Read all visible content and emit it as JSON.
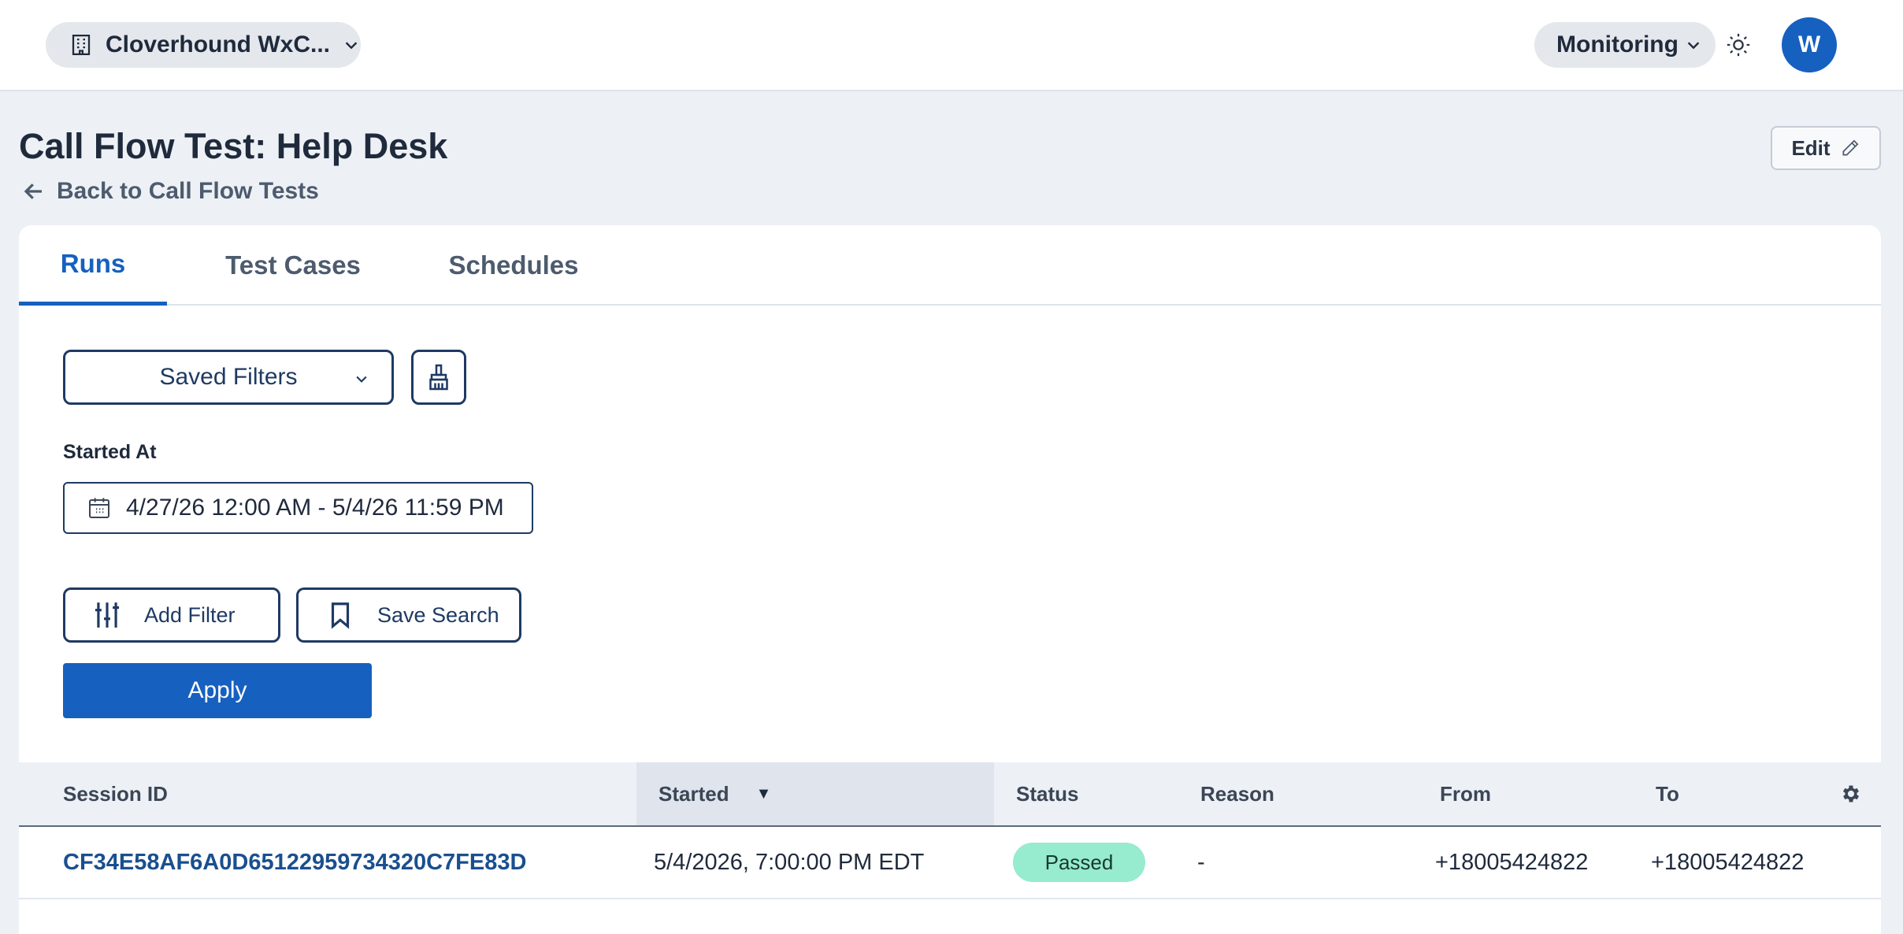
{
  "topbar": {
    "org_name": "Cloverhound WxC...",
    "section_menu": "Monitoring",
    "avatar_initial": "W"
  },
  "header": {
    "title": "Call Flow Test: Help Desk",
    "back_link": "Back to Call Flow Tests",
    "edit_label": "Edit"
  },
  "tabs": [
    {
      "label": "Runs",
      "active": true
    },
    {
      "label": "Test Cases",
      "active": false
    },
    {
      "label": "Schedules",
      "active": false
    }
  ],
  "filters": {
    "saved_filters_label": "Saved Filters",
    "started_at_label": "Started At",
    "date_range": "4/27/26 12:00 AM - 5/4/26 11:59 PM",
    "add_filter_label": "Add Filter",
    "save_search_label": "Save Search",
    "apply_label": "Apply"
  },
  "table": {
    "columns": [
      "Session ID",
      "Started",
      "Status",
      "Reason",
      "From",
      "To"
    ],
    "sort_column": "Started",
    "sort_direction": "desc",
    "rows": [
      {
        "session_id": "CF34E58AF6A0D65122959734320C7FE83D",
        "started": "5/4/2026, 7:00:00 PM EDT",
        "status": "Passed",
        "reason": "-",
        "from": "+18005424822",
        "to": "+18005424822"
      }
    ]
  },
  "colors": {
    "accent": "#1660c0",
    "navy": "#1e3a63",
    "page_bg": "#edf1f6",
    "status_passed": "#97ebcf"
  },
  "icons": {
    "org": "building-icon",
    "theme": "sun-icon",
    "back": "arrow-left-icon",
    "edit": "pencil-icon",
    "clear": "broom-icon",
    "date": "calendar-icon",
    "add_filter": "sliders-icon",
    "save_search": "bookmark-icon",
    "settings": "gear-icon"
  }
}
